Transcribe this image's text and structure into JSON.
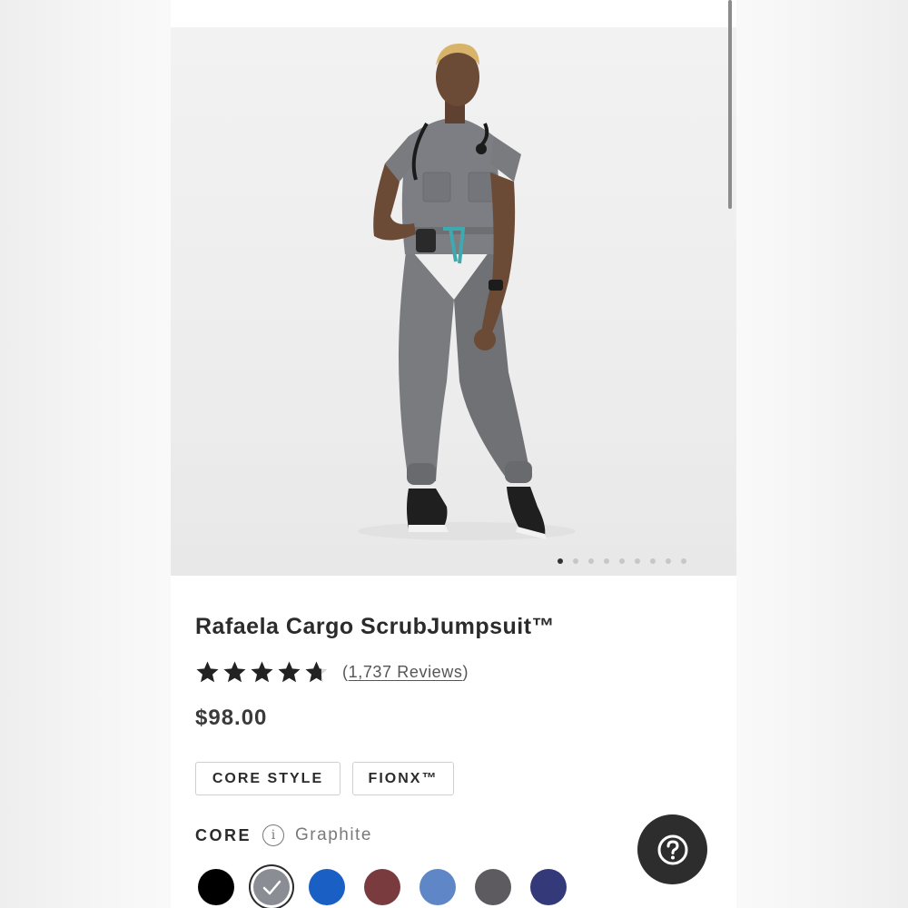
{
  "product": {
    "title": "Rafaela Cargo ScrubJumpsuit™",
    "rating_value": 4.7,
    "review_count_text": "1,737 Reviews",
    "price": "$98.00",
    "tags": [
      "CORE STYLE",
      "FIONX™"
    ]
  },
  "gallery": {
    "total_images": 9,
    "active_index": 0
  },
  "colors": {
    "category_label": "CORE",
    "selected_name": "Graphite",
    "info_icon": "info-icon",
    "swatches": [
      {
        "hex": "#000000",
        "selected": false
      },
      {
        "hex": "#8a8d93",
        "selected": true
      },
      {
        "hex": "#1a5fc4",
        "selected": false
      },
      {
        "hex": "#7a3b3f",
        "selected": false
      },
      {
        "hex": "#5f86c6",
        "selected": false
      },
      {
        "hex": "#5d5a60",
        "selected": false
      },
      {
        "hex": "#343a79",
        "selected": false
      }
    ]
  },
  "help_button": {
    "icon": "question-mark-icon"
  }
}
